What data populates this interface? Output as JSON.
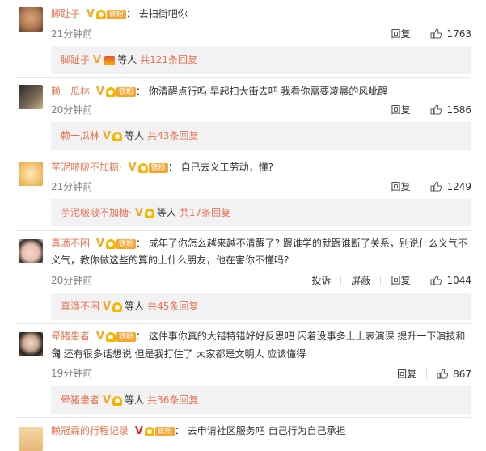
{
  "comments": [
    {
      "username": "脚趾子",
      "text": "去扫街吧你",
      "time": "21分钟前",
      "reply_label": "回复",
      "likes": "1763",
      "reply_box": {
        "username": "脚趾子",
        "etc": "等人",
        "count": "共121条回复"
      }
    },
    {
      "username": "赖一瓜林",
      "text": "你清醒点行吗 早起扫大街去吧 我看你需要凌晨的风呲醒",
      "time": "20分钟前",
      "reply_label": "回复",
      "likes": "1586",
      "reply_box": {
        "username": "赖一瓜林",
        "etc": "等人",
        "count": "共43条回复"
      }
    },
    {
      "username": "芋泥啵啵不加糖·",
      "text": "自己去义工劳动，懂?",
      "time": "21分钟前",
      "reply_label": "回复",
      "likes": "1249",
      "reply_box": {
        "username": "芋泥啵啵不加糖·",
        "etc": "等人",
        "count": "共17条回复"
      }
    },
    {
      "username": "真滴不困",
      "text_line1": "成年了你怎么越来越不清醒了? 跟谁学的就跟谁断了关系，别说什么义气不",
      "text_line2": "义气，教你做这些的算的上什么朋友，他在害你不懂吗?",
      "time": "20分钟前",
      "report_label": "投诉",
      "block_label": "屏蔽",
      "reply_label": "回复",
      "likes": "1044",
      "reply_box": {
        "username": "真滴不困",
        "etc": "等人",
        "count": "共45条回复"
      }
    },
    {
      "username": "晕猪患者",
      "text_line1": "这件事你真的大错特错好好反思吧 闲着没事多上上表演课 提升一下演技和台",
      "text_line2": "词 还有很多话想说 但是我打住了 大家都是文明人 应该懂得",
      "time": "19分钟前",
      "reply_label": "回复",
      "likes": "867",
      "reply_box": {
        "username": "晕猪患者",
        "etc": "等人",
        "count": "共36条回复"
      }
    },
    {
      "username": "赖冠霖的行程记录",
      "text": "去申请社区服务吧  自己行为自己承担"
    }
  ],
  "badges": {
    "v": "V",
    "fan_label": "铁粉"
  },
  "colors": {
    "username": "#eb7350",
    "reply_bg": "#f2f2f5",
    "v_badge": "#f5a623",
    "meta": "#808080"
  }
}
